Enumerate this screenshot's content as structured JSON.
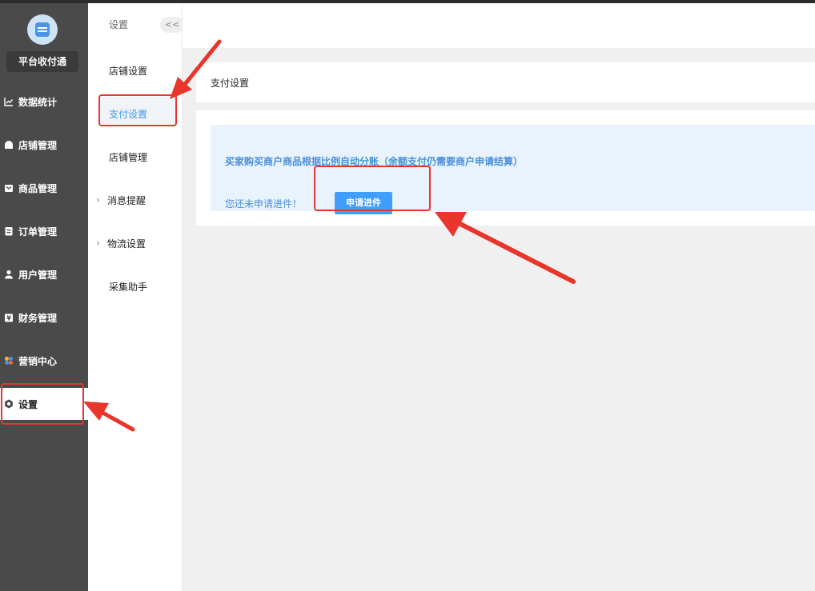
{
  "sidebar": {
    "brand": "平台收付通",
    "items": [
      {
        "label": "数据统计",
        "icon": "chart-icon"
      },
      {
        "label": "店铺管理",
        "icon": "shop-icon"
      },
      {
        "label": "商品管理",
        "icon": "goods-icon"
      },
      {
        "label": "订单管理",
        "icon": "order-icon"
      },
      {
        "label": "用户管理",
        "icon": "user-icon"
      },
      {
        "label": "财务管理",
        "icon": "finance-icon"
      },
      {
        "label": "营销中心",
        "icon": "marketing-icon"
      },
      {
        "label": "设置",
        "icon": "gear-icon"
      }
    ]
  },
  "subnav": {
    "title": "设置",
    "collapse": "<<",
    "items": [
      {
        "label": "店铺设置"
      },
      {
        "label": "支付设置"
      },
      {
        "label": "店铺管理"
      },
      {
        "label": "消息提醒"
      },
      {
        "label": "物流设置"
      },
      {
        "label": "采集助手"
      }
    ]
  },
  "main": {
    "section_title": "支付设置",
    "notice": "买家购买商户商品根据比例自动分账（余额支付仍需要商户申请结算）",
    "pending": "您还未申请进件！",
    "apply_button": "申请进件"
  },
  "colors": {
    "sidebar_bg": "#4a4a4a",
    "accent": "#409eff",
    "highlight": "#e8362d"
  }
}
